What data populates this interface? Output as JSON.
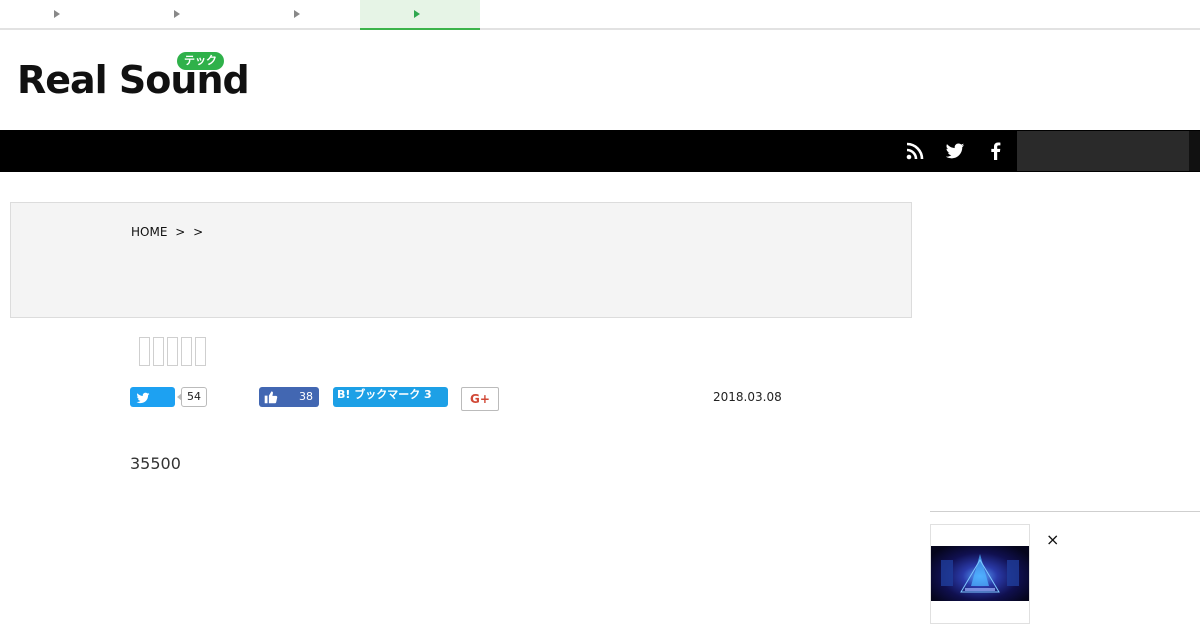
{
  "top_tabs": [
    {
      "label": "",
      "active": false
    },
    {
      "label": "",
      "active": false
    },
    {
      "label": "",
      "active": false
    },
    {
      "label": "",
      "active": true
    }
  ],
  "logo": {
    "text": "Real Sound",
    "badge": "テック"
  },
  "nav_icons": [
    "rss-icon",
    "twitter-icon",
    "facebook-icon"
  ],
  "search": {
    "placeholder": ""
  },
  "breadcrumb": {
    "home": "HOME",
    "sep1": ">",
    "sep2": ">"
  },
  "share": {
    "twitter_count": "54",
    "facebook_count": "38",
    "hatena_label": "B! ブックマーク 3",
    "google_plus_label": "G+"
  },
  "post_date": "2018.03.08",
  "body_text": "35500",
  "popup": {
    "close_label": "×"
  },
  "colors": {
    "accent": "#2fb14a",
    "twitter": "#1da1f2",
    "facebook": "#4267b2",
    "hatena": "#1da0e6",
    "navbar": "#000000"
  }
}
